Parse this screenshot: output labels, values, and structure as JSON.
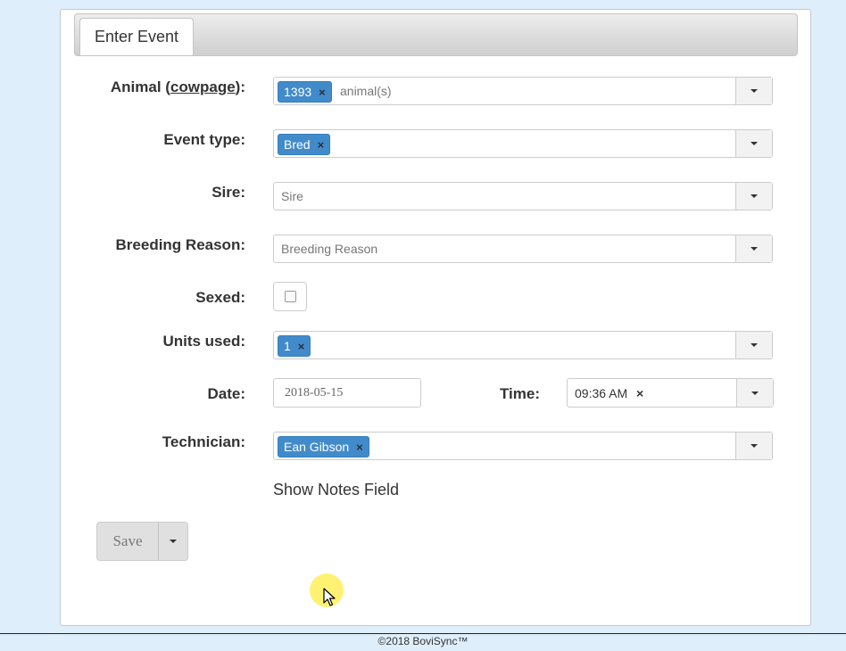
{
  "tab": {
    "label": "Enter Event"
  },
  "form": {
    "animal": {
      "label_prefix": "Animal (",
      "label_link": "cowpage",
      "label_suffix": "):",
      "chip": "1393",
      "placeholder": "animal(s)"
    },
    "event_type": {
      "label": "Event type:",
      "chip": "Bred"
    },
    "sire": {
      "label": "Sire:",
      "placeholder": "Sire"
    },
    "breeding_reason": {
      "label": "Breeding Reason:",
      "placeholder": "Breeding Reason"
    },
    "sexed": {
      "label": "Sexed:",
      "checked": false
    },
    "units_used": {
      "label": "Units used:",
      "chip": "1"
    },
    "date": {
      "label": "Date:",
      "value": "2018-05-15"
    },
    "time": {
      "label": "Time:",
      "value": "09:36 AM"
    },
    "technician": {
      "label": "Technician:",
      "chip": "Ean Gibson"
    },
    "notes_link": "Show Notes Field"
  },
  "actions": {
    "save_label": "Save"
  },
  "chip_remove": "×",
  "footer": {
    "copyright": "©2018 BoviSync™"
  },
  "colors": {
    "chip_bg": "#428bca",
    "page_bg": "#dfeefb"
  }
}
